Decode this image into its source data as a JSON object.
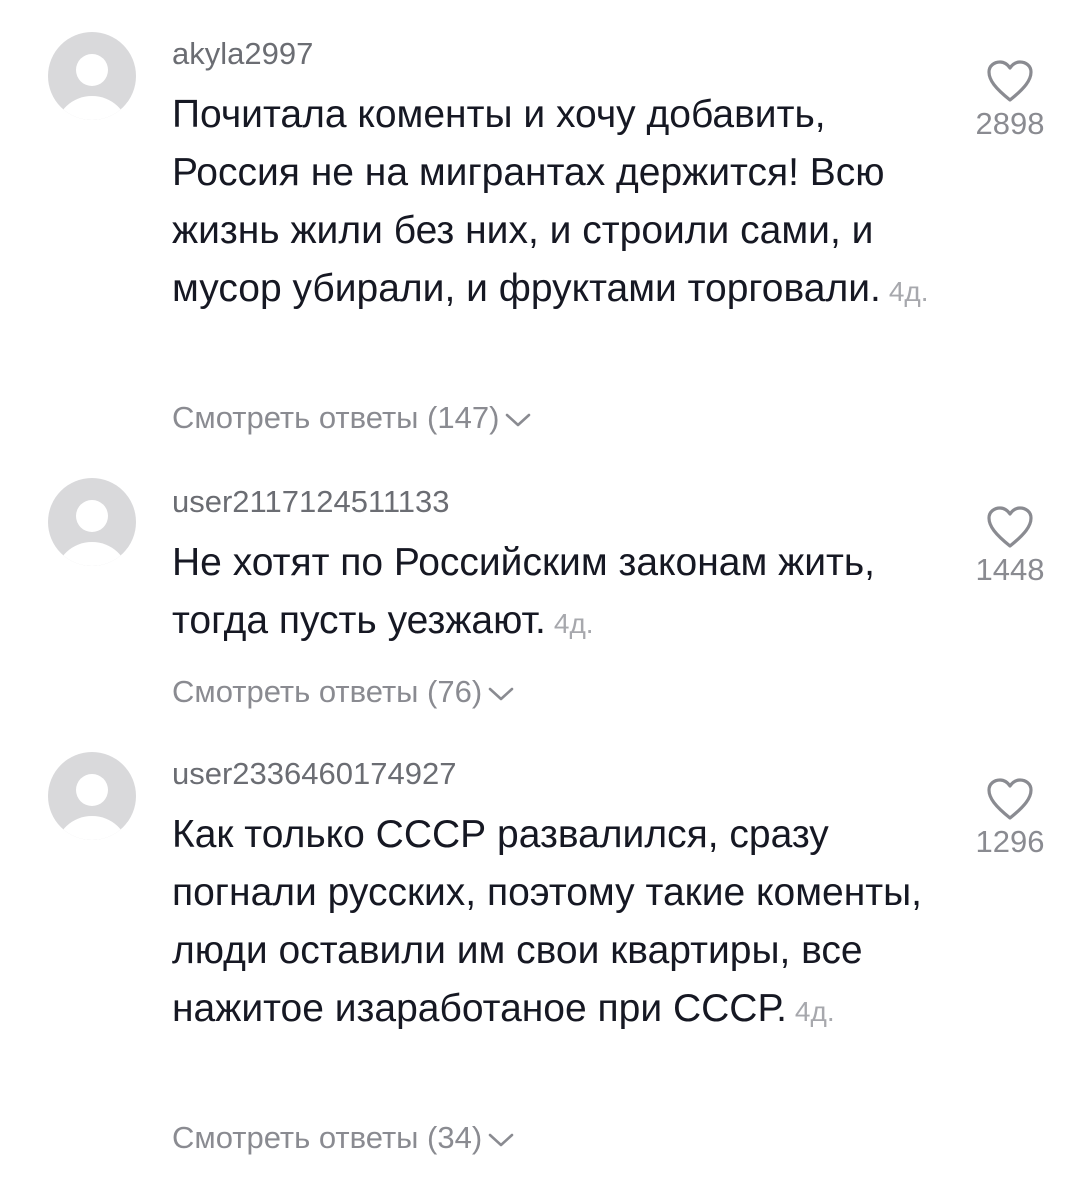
{
  "comments": [
    {
      "username": "akyla2997",
      "text": "Почитала коменты и хочу добавить, Россия не на мигрантах держится! Всю жизнь жили без них, и строили сами, и мусор убирали, и фруктами торговали.",
      "time": "4д.",
      "replies": "Смотреть ответы (147)",
      "likes": "2898"
    },
    {
      "username": "user2117124511133",
      "text": "Не хотят по Российским законам жить, тогда пусть уезжают.",
      "time": "4д.",
      "replies": "Смотреть ответы (76)",
      "likes": "1448"
    },
    {
      "username": "user2336460174927",
      "text": "Как только СССР развалился, сразу погнали русских, поэтому такие коменты, люди оставили им свои квартиры, все нажитое изаработаное при СССР.",
      "time": "4д.",
      "replies": "Смотреть ответы (34)",
      "likes": "1296"
    }
  ],
  "icons": {
    "avatar": "default-avatar-icon",
    "like": "heart-outline-icon",
    "expand": "chevron-down-icon"
  },
  "colors": {
    "text": "#161823",
    "secondary": "#8a8b91",
    "avatar_bg": "#d9d9db"
  }
}
